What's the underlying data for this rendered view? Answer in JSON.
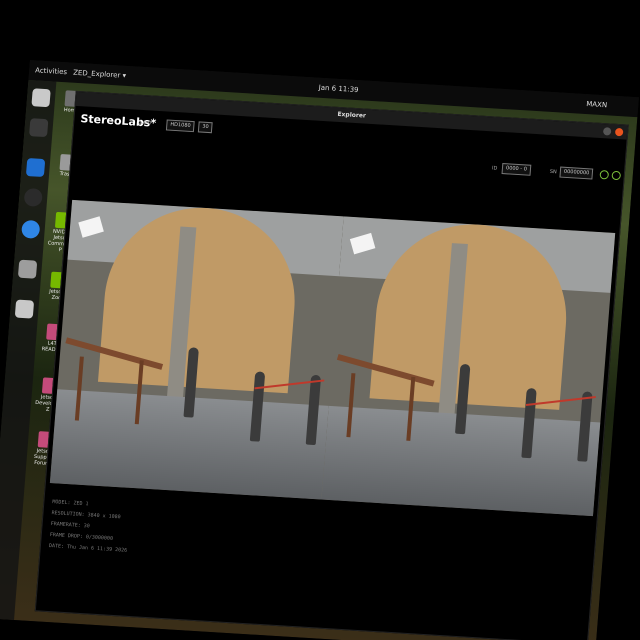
{
  "topbar": {
    "activities": "Activities",
    "app_menu": "ZED_Explorer ▾",
    "clock": "Jan 6  11:39",
    "maxn": "MAXN"
  },
  "desktop": {
    "icons": [
      {
        "label": "Home"
      },
      {
        "label": "Trash"
      },
      {
        "label": "NVIDIA Jetson Community P"
      },
      {
        "label": "Jetson Zoo"
      },
      {
        "label": "L4T-README"
      },
      {
        "label": "Jetson Developer Z"
      },
      {
        "label": "Jetson Support Forums"
      }
    ]
  },
  "window": {
    "title": "Explorer",
    "brand": "StereoLabs*",
    "version": "1.0.0",
    "resolution_select": "HD1080",
    "fps_select": "30",
    "id_label": "ID",
    "id_select": "0000 - 0",
    "sn_label": "SN",
    "sn_value": "00000000"
  },
  "info": {
    "model": "MODEL: ZED 1",
    "resolution": "RESOLUTION: 3840 x 1080",
    "framerate": "FRAMERATE: 30",
    "frame_drop": "FRAME DROP: 0/3000000",
    "date": "DATE: Thu Jan 6 11:39 2026"
  },
  "colors": {
    "accent": "#7bbf3a",
    "close": "#e9541e",
    "rope": "#c0392b"
  }
}
